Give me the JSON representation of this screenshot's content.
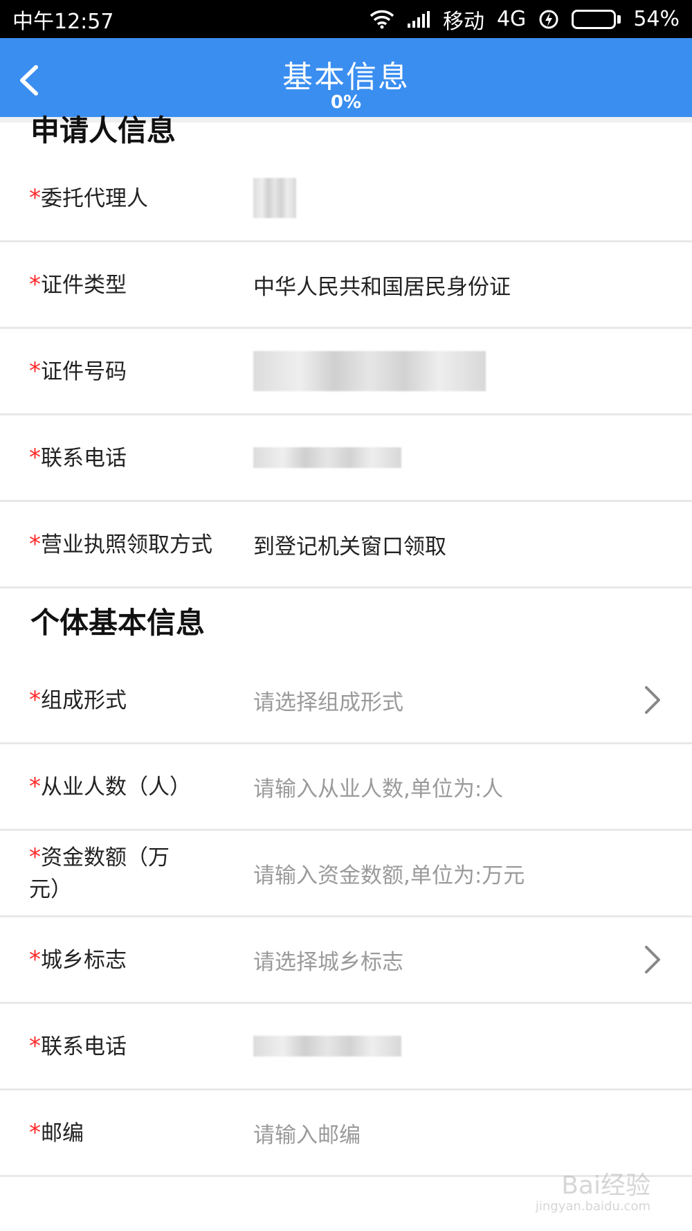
{
  "status_bar": {
    "time": "中午12:57",
    "carrier": "移动",
    "network": "4G",
    "battery": "54%",
    "battery_level": 0.54
  },
  "header": {
    "title": "基本信息",
    "progress": "0%"
  },
  "sections": {
    "applicant_title": "申请人信息",
    "individual_title": "个体基本信息"
  },
  "applicant": {
    "agent_label": "委托代理人",
    "id_type_label": "证件类型",
    "id_type_value": "中华人民共和国居民身份证",
    "id_number_label": "证件号码",
    "phone_label": "联系电话",
    "license_method_label": "营业执照领取方式",
    "license_method_value": "到登记机关窗口领取"
  },
  "individual": {
    "form_label": "组成形式",
    "form_placeholder": "请选择组成形式",
    "employees_label": "从业人数（人）",
    "employees_placeholder": "请输入从业人数,单位为:人",
    "capital_label": "资金数额（万元）",
    "capital_placeholder": "请输入资金数额,单位为:万元",
    "urban_rural_label": "城乡标志",
    "urban_rural_placeholder": "请选择城乡标志",
    "phone_label": "联系电话",
    "postcode_label": "邮编",
    "postcode_placeholder": "请输入邮编"
  },
  "required_mark": "*",
  "watermark": {
    "text": "Bai经验",
    "sub": "jingyan.baidu.com"
  },
  "colors": {
    "header_bg": "#3a8ef0",
    "required": "#ff2a2a",
    "placeholder": "#9a9a9a"
  }
}
